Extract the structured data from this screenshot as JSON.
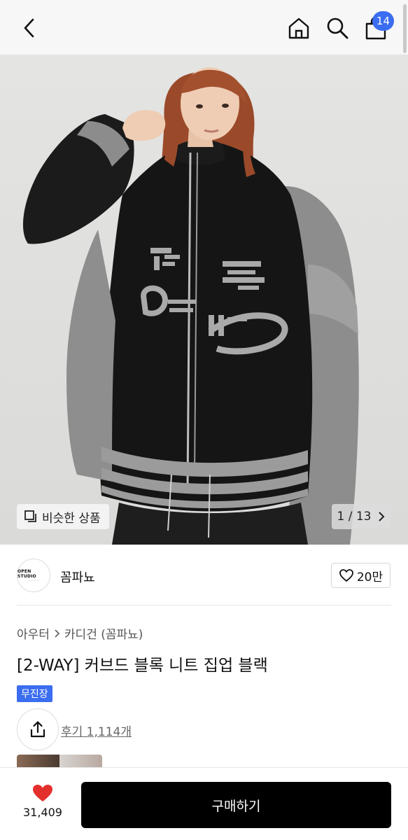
{
  "header": {
    "cart_count": "14"
  },
  "gallery": {
    "similar_label": "비슷한 상품",
    "counter": "1 / 13"
  },
  "brand": {
    "logo_text": "OPEN STUDIO",
    "name": "꼼파뇨",
    "likes": "20만"
  },
  "product": {
    "breadcrumb": [
      "아우터",
      "카디건 (꼼파뇨)"
    ],
    "title": "[2-WAY] 커브드 블록 니트 집업 블랙",
    "tag": "무진장",
    "reviews": "후기 1,114개"
  },
  "bottom": {
    "wish_count": "31,409",
    "buy_label": "구매하기"
  },
  "colors": {
    "accent": "#3b6df0",
    "wish_heart": "#e3302c",
    "buy_button": "#000000"
  }
}
